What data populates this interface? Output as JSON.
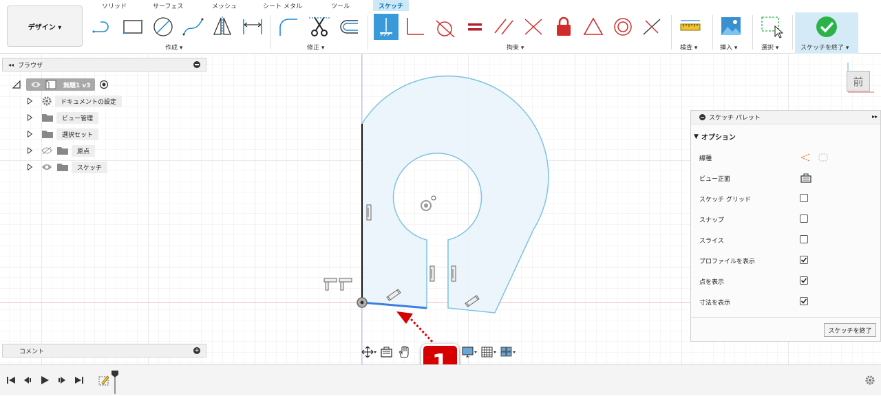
{
  "workspace": {
    "label": "デザイン ▾"
  },
  "tabs": [
    {
      "label": "ソリッド"
    },
    {
      "label": "サーフェス"
    },
    {
      "label": "メッシュ"
    },
    {
      "label": "シート メタル"
    },
    {
      "label": "ツール"
    },
    {
      "label": "スケッチ"
    }
  ],
  "groups": {
    "create": "作成 ▾",
    "modify": "修正 ▾",
    "constraints": "拘束 ▾",
    "inspect": "検査 ▾",
    "insert": "挿入 ▾",
    "select": "選択 ▾",
    "finish": "スケッチを終了 ▾"
  },
  "browser": {
    "title": "ブラウザ",
    "root": "無題1 v3",
    "items": [
      {
        "label": "ドキュメントの設定"
      },
      {
        "label": "ビュー管理"
      },
      {
        "label": "選択セット"
      },
      {
        "label": "原点"
      },
      {
        "label": "スケッチ"
      }
    ]
  },
  "comments": {
    "title": "コメント"
  },
  "viewcube": {
    "label": "前"
  },
  "palette": {
    "title": "スケッチ パレット",
    "section": "オプション",
    "rows": [
      {
        "label": "線種",
        "type": "icons"
      },
      {
        "label": "ビュー正面",
        "type": "icon"
      },
      {
        "label": "スケッチ グリッド",
        "checked": false
      },
      {
        "label": "スナップ",
        "checked": false
      },
      {
        "label": "スライス",
        "checked": false
      },
      {
        "label": "プロファイルを表示",
        "checked": true
      },
      {
        "label": "点を表示",
        "checked": true
      },
      {
        "label": "寸法を表示",
        "checked": true
      }
    ],
    "finish_button": "スケッチを終了"
  },
  "callout": {
    "number": "1"
  },
  "colors": {
    "accent": "#3a9ad9",
    "sketch_curve": "#7cc3e3",
    "profile_fill": "#eaf4fb",
    "badge": "#d60000",
    "ok_green": "#2bb34a",
    "constraint_red": "#d22b2b"
  }
}
